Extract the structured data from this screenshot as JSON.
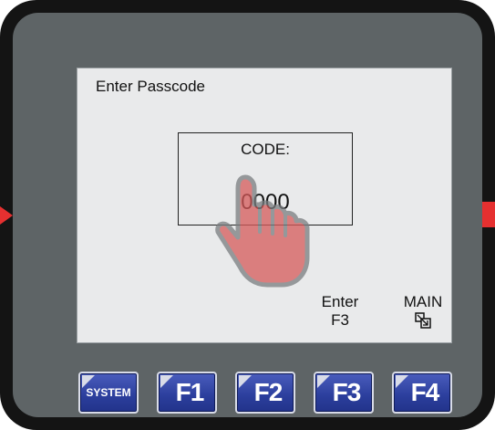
{
  "screen": {
    "title": "Enter Passcode",
    "code_label": "CODE:",
    "code_value": "0000"
  },
  "softkeys": {
    "enter_line1": "Enter",
    "enter_line2": "F3",
    "main_label": "MAIN"
  },
  "keys": [
    {
      "label": "SYSTEM"
    },
    {
      "label": "F1"
    },
    {
      "label": "F2"
    },
    {
      "label": "F3"
    },
    {
      "label": "F4"
    }
  ],
  "colors": {
    "key_blue": "#2b3e9c",
    "indicator_red": "#e53030",
    "screen_bg": "#e9eaeb",
    "panel_gray": "#5e6466"
  },
  "icons": {
    "pointer": "hand-pointer-icon",
    "main": "window-switch-icon"
  }
}
